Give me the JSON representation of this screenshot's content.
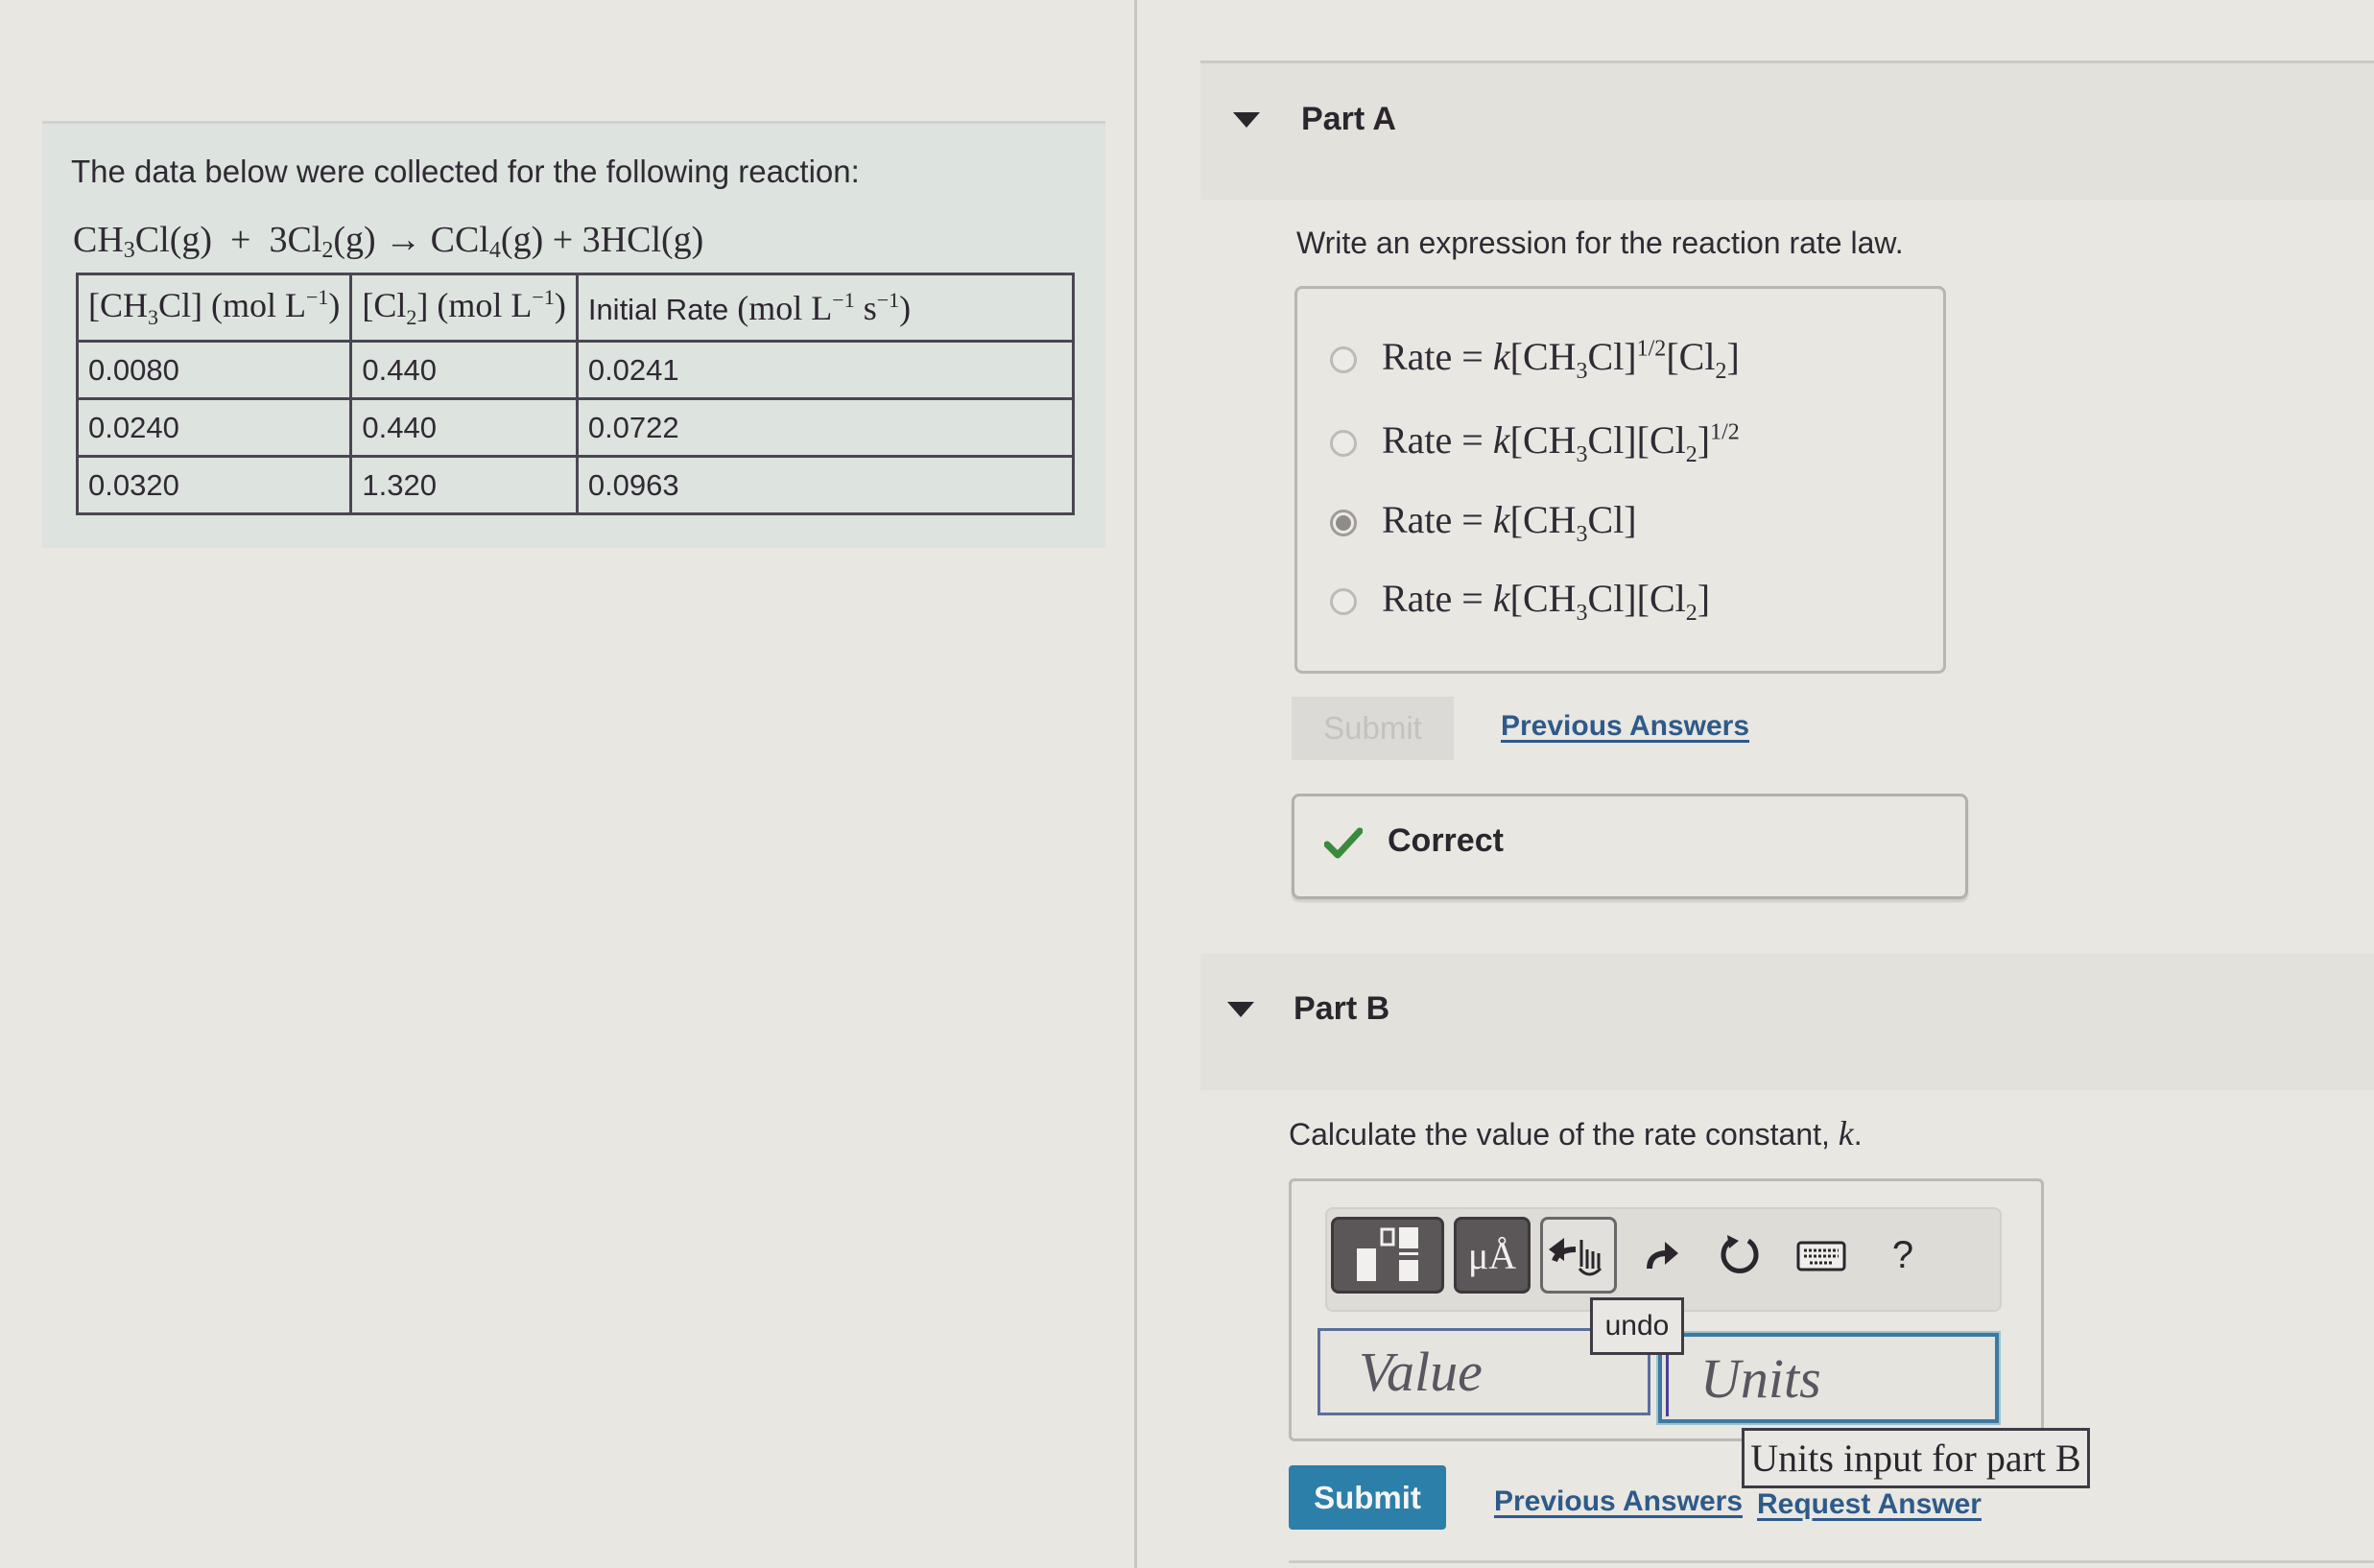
{
  "problem": {
    "intro": "The data below were collected for the following reaction:",
    "equation": {
      "reactant1": "CH3Cl(g)",
      "plus1": "+",
      "reactant2": "3Cl2(g)",
      "arrow": "→",
      "product1": "CCl4(g)",
      "plus2": "+",
      "product2": "3HCl(g)"
    },
    "table": {
      "headers": [
        "[CH3Cl] (mol L^-1)",
        "[Cl2] (mol L^-1)",
        "Initial Rate (mol L^-1 s^-1)"
      ],
      "rows": [
        [
          "0.0080",
          "0.440",
          "0.0241"
        ],
        [
          "0.0240",
          "0.440",
          "0.0722"
        ],
        [
          "0.0320",
          "1.320",
          "0.0963"
        ]
      ]
    }
  },
  "part_a": {
    "title": "Part A",
    "prompt": "Write an expression for the reaction rate law.",
    "options": [
      {
        "label": "Rate = k[CH3Cl]^1/2[Cl2]",
        "selected": false
      },
      {
        "label": "Rate = k[CH3Cl][Cl2]^1/2",
        "selected": false
      },
      {
        "label": "Rate = k[CH3Cl]",
        "selected": true
      },
      {
        "label": "Rate = k[CH3Cl][Cl2]",
        "selected": false
      }
    ],
    "submit_label": "Submit",
    "previous_answers_label": "Previous Answers",
    "feedback": {
      "status": "Correct",
      "icon": "checkmark-icon",
      "color": "#3a8a3e"
    }
  },
  "part_b": {
    "title": "Part B",
    "prompt_text": "Calculate the value of the rate constant,",
    "prompt_var": "k",
    "prompt_end": ".",
    "toolbar": {
      "buttons": [
        {
          "icon": "templates-icon"
        },
        {
          "icon": "units-icon",
          "label": "μÅ"
        },
        {
          "icon": "undo-icon"
        },
        {
          "icon": "redo-icon"
        },
        {
          "icon": "reset-icon"
        },
        {
          "icon": "keyboard-icon"
        },
        {
          "icon": "help-icon",
          "label": "?"
        }
      ]
    },
    "value_placeholder": "Value",
    "units_placeholder": "Units",
    "undo_tooltip": "undo",
    "units_tooltip": "Units input for part B",
    "submit_label": "Submit",
    "previous_answers_label": "Previous Answers",
    "request_answer_label": "Request Answer",
    "accent_color": "#2c7fa8"
  }
}
